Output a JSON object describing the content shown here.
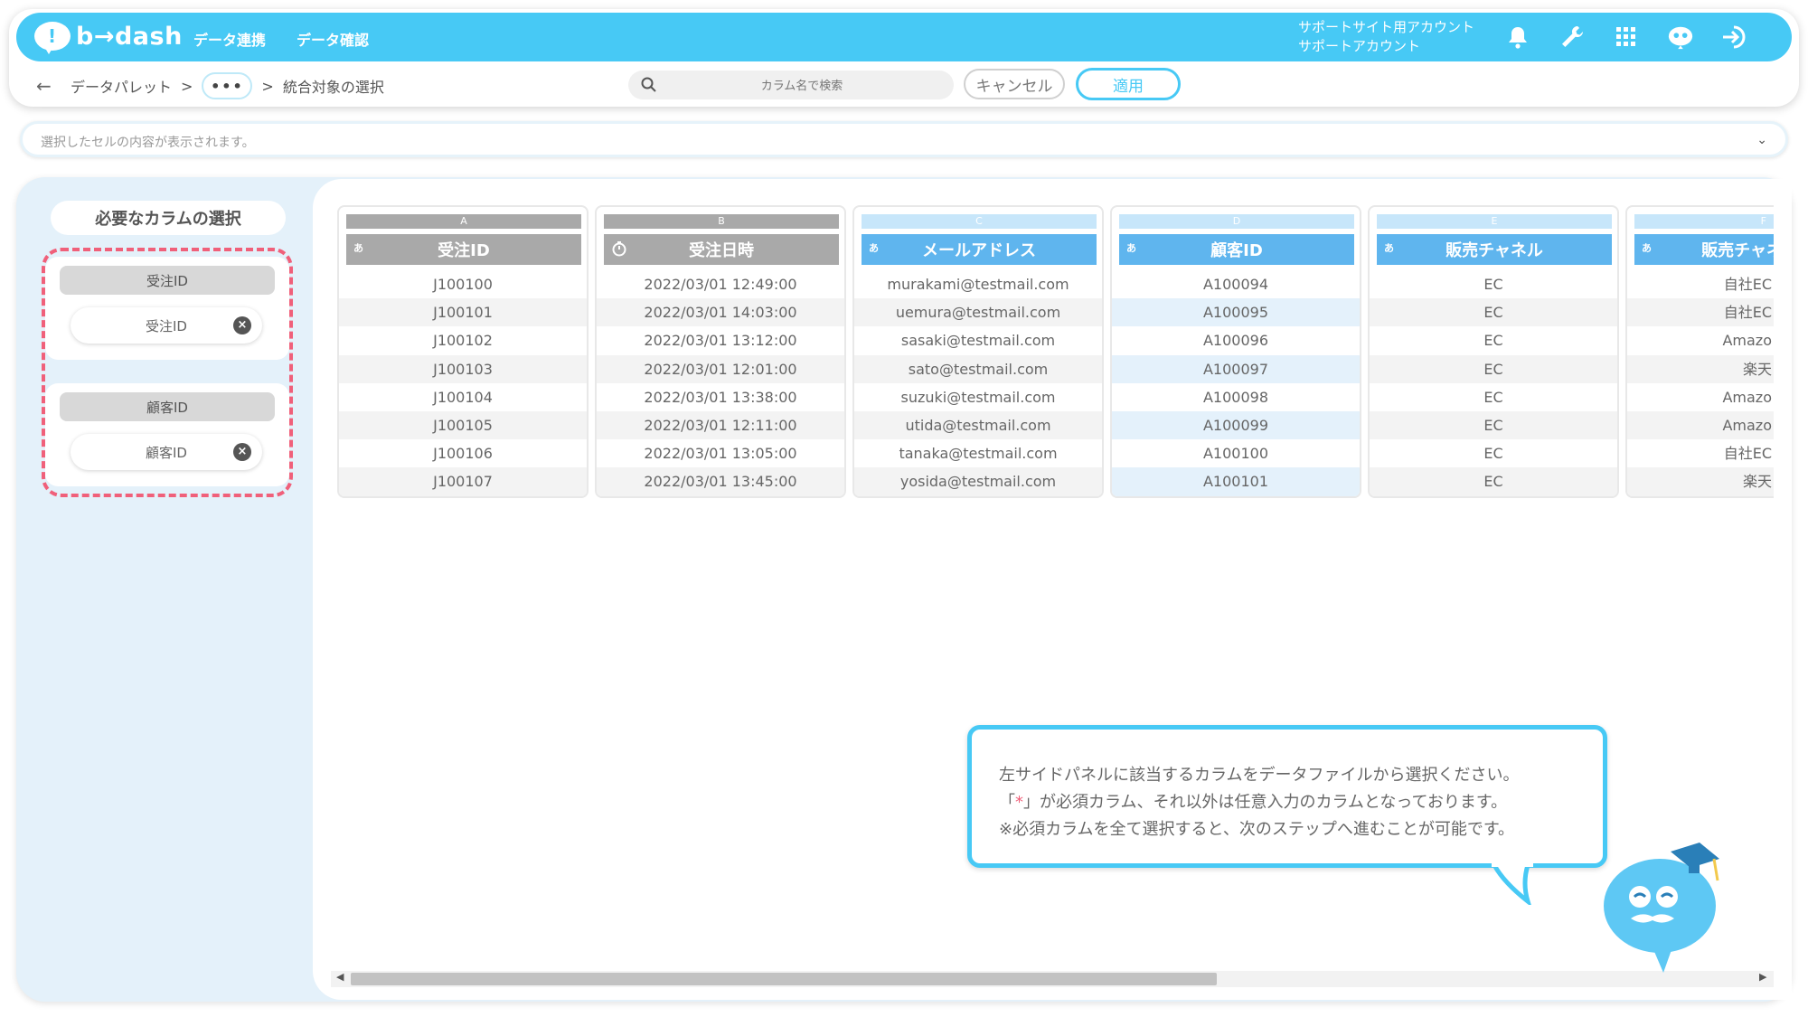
{
  "app": {
    "logo_text": "b→dash",
    "nav": [
      "データ連携",
      "データ確認"
    ],
    "account_line1": "サポートサイト用アカウント",
    "account_line2": "サポートアカウント",
    "accent_color": "#47c9f5"
  },
  "breadcrumb": {
    "back_icon": "arrow-left-icon",
    "item1": "データパレット",
    "sep": ">",
    "more": "•••",
    "current": "統合対象の選択"
  },
  "search": {
    "placeholder": "カラム名で検索"
  },
  "toolbar": {
    "cancel_label": "キャンセル",
    "apply_label": "適用"
  },
  "cell_content_bar": {
    "placeholder": "選択したセルの内容が表示されます。"
  },
  "left_panel": {
    "title": "必要なカラムの選択",
    "groups": [
      {
        "header": "受注ID",
        "selected": "受注ID"
      },
      {
        "header": "顧客ID",
        "selected": "顧客ID"
      }
    ]
  },
  "table": {
    "columns": [
      {
        "letter": "A",
        "type_icon": "あ",
        "name": "受注ID",
        "style": "grey",
        "rows": [
          "J100100",
          "J100101",
          "J100102",
          "J100103",
          "J100104",
          "J100105",
          "J100106",
          "J100107"
        ]
      },
      {
        "letter": "B",
        "type_icon": "timer-icon",
        "name": "受注日時",
        "style": "grey",
        "rows": [
          "2022/03/01 12:49:00",
          "2022/03/01 14:03:00",
          "2022/03/01 13:12:00",
          "2022/03/01 12:01:00",
          "2022/03/01 13:38:00",
          "2022/03/01 12:11:00",
          "2022/03/01 13:05:00",
          "2022/03/01 13:45:00"
        ]
      },
      {
        "letter": "C",
        "type_icon": "あ",
        "name": "メールアドレス",
        "style": "blue",
        "rows": [
          "murakami@testmail.com",
          "uemura@testmail.com",
          "sasaki@testmail.com",
          "sato@testmail.com",
          "suzuki@testmail.com",
          "utida@testmail.com",
          "tanaka@testmail.com",
          "yosida@testmail.com"
        ]
      },
      {
        "letter": "D",
        "type_icon": "あ",
        "name": "顧客ID",
        "style": "blue",
        "rows": [
          "A100094",
          "A100095",
          "A100096",
          "A100097",
          "A100098",
          "A100099",
          "A100100",
          "A100101"
        ]
      },
      {
        "letter": "E",
        "type_icon": "あ",
        "name": "販売チャネル",
        "style": "blue",
        "rows": [
          "EC",
          "EC",
          "EC",
          "EC",
          "EC",
          "EC",
          "EC",
          "EC"
        ]
      },
      {
        "letter": "F",
        "type_icon": "あ",
        "name": "販売チャネル",
        "style": "blue",
        "rows": [
          "自社EC",
          "自社EC",
          "Amazo",
          "楽天",
          "Amazo",
          "Amazo",
          "自社EC",
          "楽天"
        ]
      }
    ]
  },
  "tooltip": {
    "line1": "左サイドパネルに該当するカラムをデータファイルから選択ください。",
    "line2_open": "「",
    "line2_star": "*",
    "line2_rest": "」が必須カラム、それ以外は任意入力のカラムとなっております。",
    "line3": "※必須カラムを全て選択すると、次のステップへ進むことが可能です。"
  }
}
